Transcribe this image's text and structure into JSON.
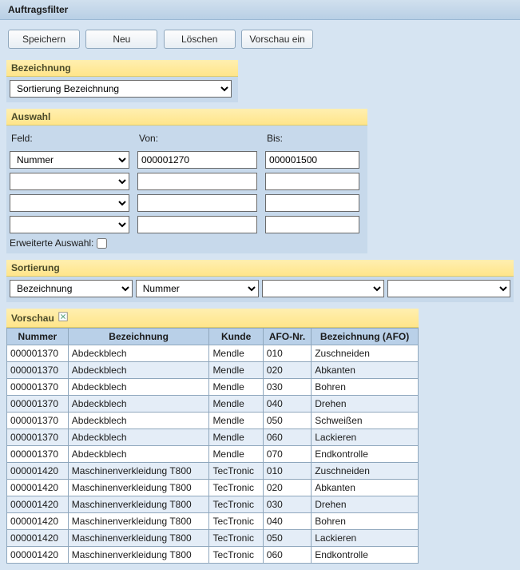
{
  "title": "Auftragsfilter",
  "toolbar": {
    "save": "Speichern",
    "new": "Neu",
    "delete": "Löschen",
    "preview": "Vorschau ein"
  },
  "bezeichnung": {
    "header": "Bezeichnung",
    "value": "Sortierung Bezeichnung"
  },
  "auswahl": {
    "header": "Auswahl",
    "labels": {
      "feld": "Feld:",
      "von": "Von:",
      "bis": "Bis:"
    },
    "rows": [
      {
        "feld": "Nummer",
        "von": "000001270",
        "bis": "000001500"
      },
      {
        "feld": "",
        "von": "",
        "bis": ""
      },
      {
        "feld": "",
        "von": "",
        "bis": ""
      },
      {
        "feld": "",
        "von": "",
        "bis": ""
      }
    ],
    "erweitert_label": "Erweiterte Auswahl:",
    "erweitert_checked": false
  },
  "sortierung": {
    "header": "Sortierung",
    "values": [
      "Bezeichnung",
      "Nummer",
      "",
      ""
    ]
  },
  "vorschau": {
    "header": "Vorschau",
    "columns": [
      "Nummer",
      "Bezeichnung",
      "Kunde",
      "AFO-Nr.",
      "Bezeichnung (AFO)"
    ],
    "rows": [
      [
        "000001370",
        "Abdeckblech",
        "Mendle",
        "010",
        "Zuschneiden"
      ],
      [
        "000001370",
        "Abdeckblech",
        "Mendle",
        "020",
        "Abkanten"
      ],
      [
        "000001370",
        "Abdeckblech",
        "Mendle",
        "030",
        "Bohren"
      ],
      [
        "000001370",
        "Abdeckblech",
        "Mendle",
        "040",
        "Drehen"
      ],
      [
        "000001370",
        "Abdeckblech",
        "Mendle",
        "050",
        "Schweißen"
      ],
      [
        "000001370",
        "Abdeckblech",
        "Mendle",
        "060",
        "Lackieren"
      ],
      [
        "000001370",
        "Abdeckblech",
        "Mendle",
        "070",
        "Endkontrolle"
      ],
      [
        "000001420",
        "Maschinenverkleidung T800",
        "TecTronic",
        "010",
        "Zuschneiden"
      ],
      [
        "000001420",
        "Maschinenverkleidung T800",
        "TecTronic",
        "020",
        "Abkanten"
      ],
      [
        "000001420",
        "Maschinenverkleidung T800",
        "TecTronic",
        "030",
        "Drehen"
      ],
      [
        "000001420",
        "Maschinenverkleidung T800",
        "TecTronic",
        "040",
        "Bohren"
      ],
      [
        "000001420",
        "Maschinenverkleidung T800",
        "TecTronic",
        "050",
        "Lackieren"
      ],
      [
        "000001420",
        "Maschinenverkleidung T800",
        "TecTronic",
        "060",
        "Endkontrolle"
      ]
    ]
  }
}
